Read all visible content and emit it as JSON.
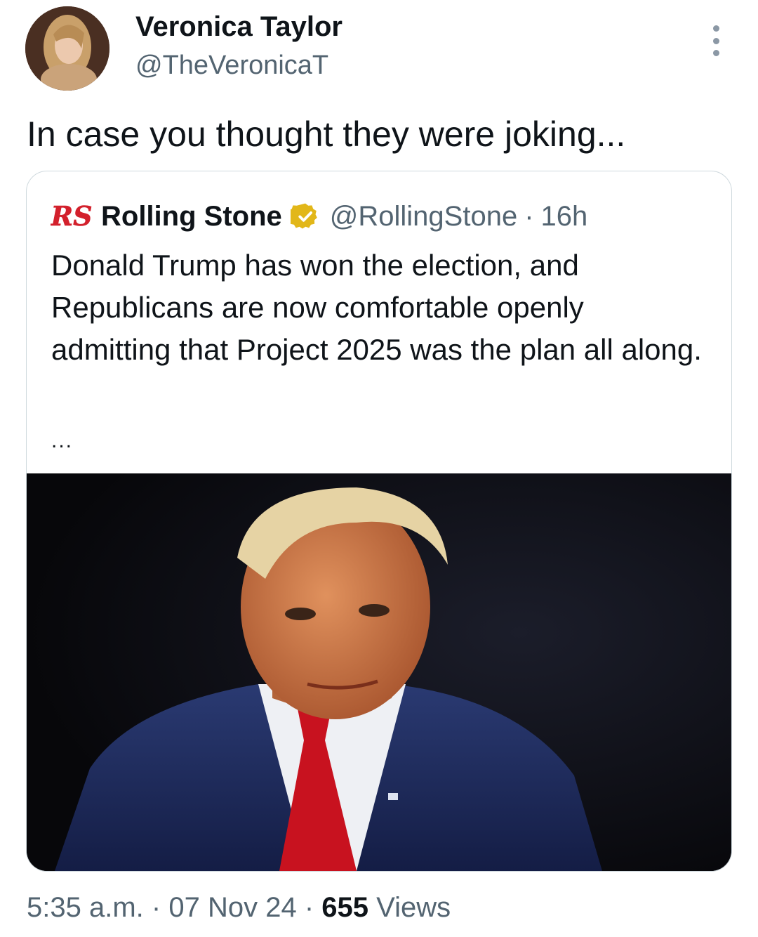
{
  "author": {
    "name": "Veronica Taylor",
    "handle": "@TheVeronicaT"
  },
  "tweet": {
    "text": "In case you thought they were joking..."
  },
  "quoted_tweet": {
    "logo_text": "RS",
    "name": "Rolling Stone",
    "handle": "@RollingStone",
    "separator": "·",
    "time": "16h",
    "text": "Donald Trump has won the election, and Republicans are now comfortable openly admitting that Project 2025 was the plan all along.",
    "ellipsis": "..."
  },
  "footer": {
    "time": "5:35 a.m.",
    "sep1": "·",
    "date": "07 Nov 24",
    "sep2": "·",
    "views_count": "655",
    "views_label": "Views"
  },
  "colors": {
    "text_primary": "#0f1419",
    "text_secondary": "#536471",
    "border": "#cfd9de",
    "verified_gold": "#e2b719",
    "rs_red": "#d3202c"
  },
  "icons": {
    "more": "more-vertical-icon",
    "verified": "verified-gold-badge-icon",
    "logo": "rolling-stone-logo"
  }
}
